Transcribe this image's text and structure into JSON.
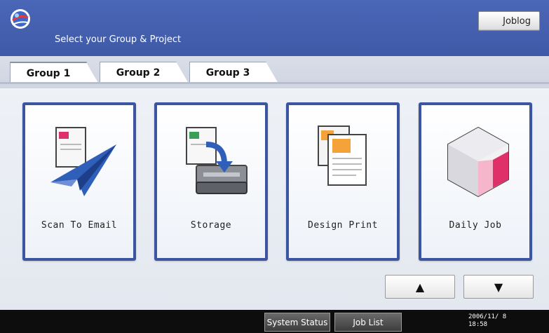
{
  "header": {
    "subtitle": "Select your Group & Project",
    "joblog_label": "Joblog",
    "logo_icon": "globe-logo-icon"
  },
  "tabs": [
    {
      "label": "Group 1",
      "active": true
    },
    {
      "label": "Group 2",
      "active": false
    },
    {
      "label": "Group 3",
      "active": false
    }
  ],
  "tiles": [
    {
      "label": "Scan To Email",
      "icon": "paper-plane-icon"
    },
    {
      "label": "Storage",
      "icon": "storage-icon"
    },
    {
      "label": "Design Print",
      "icon": "design-print-icon"
    },
    {
      "label": "Daily Job",
      "icon": "cube-icon"
    }
  ],
  "nav": {
    "up_label": "▲",
    "down_label": "▼"
  },
  "footer": {
    "system_status_label": "System Status",
    "job_list_label": "Job List",
    "date": "2006/11/ 8",
    "time": "18:58"
  },
  "colors": {
    "header_blue": "#4a66b6",
    "tile_border": "#3c55a0",
    "footer_bg": "#0d0d0d",
    "accent_pink": "#e0306a",
    "accent_orange": "#f3a33a"
  }
}
